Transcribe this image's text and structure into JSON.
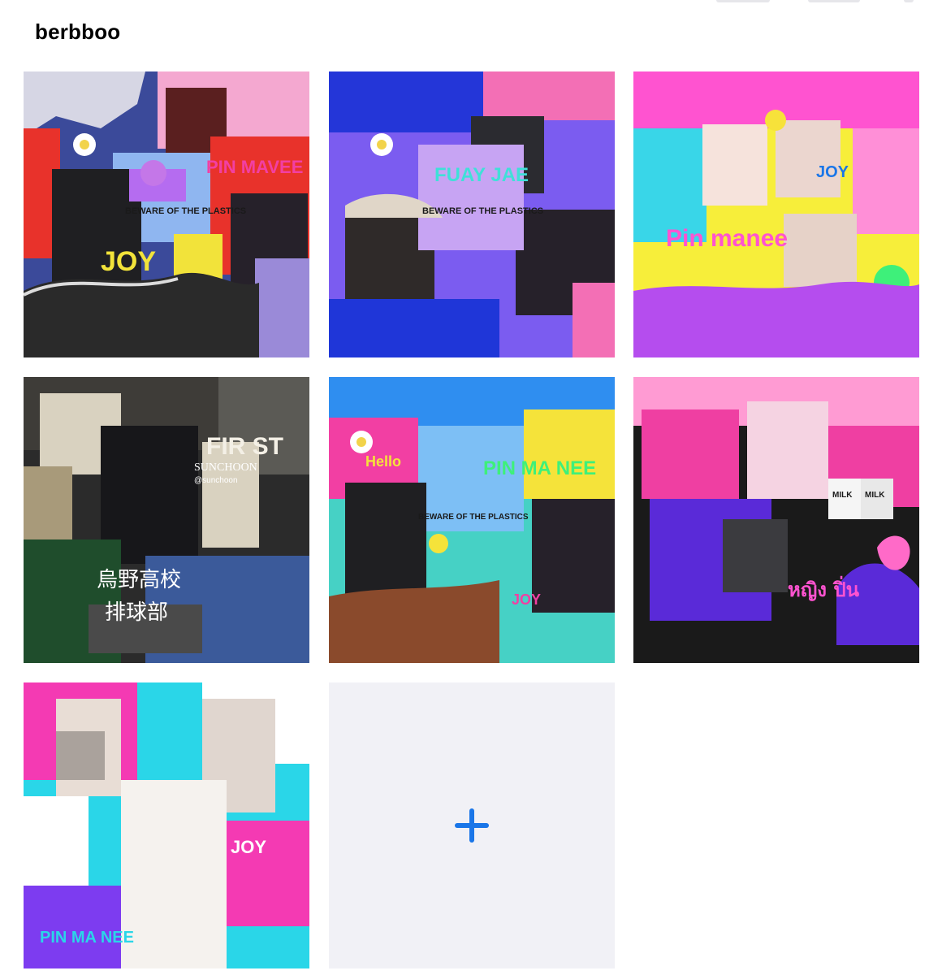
{
  "header": {
    "title": "berbboo"
  },
  "gallery": {
    "items": [
      {
        "texts": [
          "PIN MAVEE",
          "BEWARE OF THE PLASTICS",
          "JOY"
        ],
        "palette": [
          "#3b4a9a",
          "#e8322b",
          "#b56cf0",
          "#f2e33a",
          "#2a2a2a"
        ]
      },
      {
        "texts": [
          "FUAY JAE",
          "BEWARE OF THE PLASTICS"
        ],
        "palette": [
          "#2436d8",
          "#7b5cf0",
          "#e6d7f5",
          "#f36fb5",
          "#c7a4f3"
        ]
      },
      {
        "texts": [
          "JOY",
          "Pin manee"
        ],
        "palette": [
          "#ff53d0",
          "#f7ee3a",
          "#39d6e8",
          "#b54dee",
          "#ff8fd7"
        ]
      },
      {
        "texts": [
          "FIR ST",
          "SUNCHOON",
          "@sunchoon",
          "烏野高校",
          "排球部"
        ],
        "palette": [
          "#2b2b2b",
          "#3b5a9a",
          "#a89a7a",
          "#1f4d2c",
          "#d9d2c0"
        ]
      },
      {
        "texts": [
          "Hello",
          "PIN MA NEE",
          "BEWARE OF THE PLASTICS",
          "JOY"
        ],
        "palette": [
          "#2f8ef0",
          "#f23fa3",
          "#f5e33a",
          "#8a4a2c",
          "#46d1c5"
        ]
      },
      {
        "texts": [
          "MILK",
          "MILK",
          "หญิง ปิ่น"
        ],
        "palette": [
          "#ef3fa2",
          "#1a1a1a",
          "#ff9bd3",
          "#5a2ad8",
          "#f5f5f5"
        ]
      },
      {
        "texts": [
          "PIN MA NEE",
          "JOY"
        ],
        "palette": [
          "#f43ab3",
          "#2ad6e8",
          "#ffffff",
          "#7d3cf0",
          "#1a1a1a"
        ]
      }
    ],
    "add_button": {
      "icon": "plus-icon",
      "symbol": "+",
      "color": "#1a76e8"
    }
  }
}
